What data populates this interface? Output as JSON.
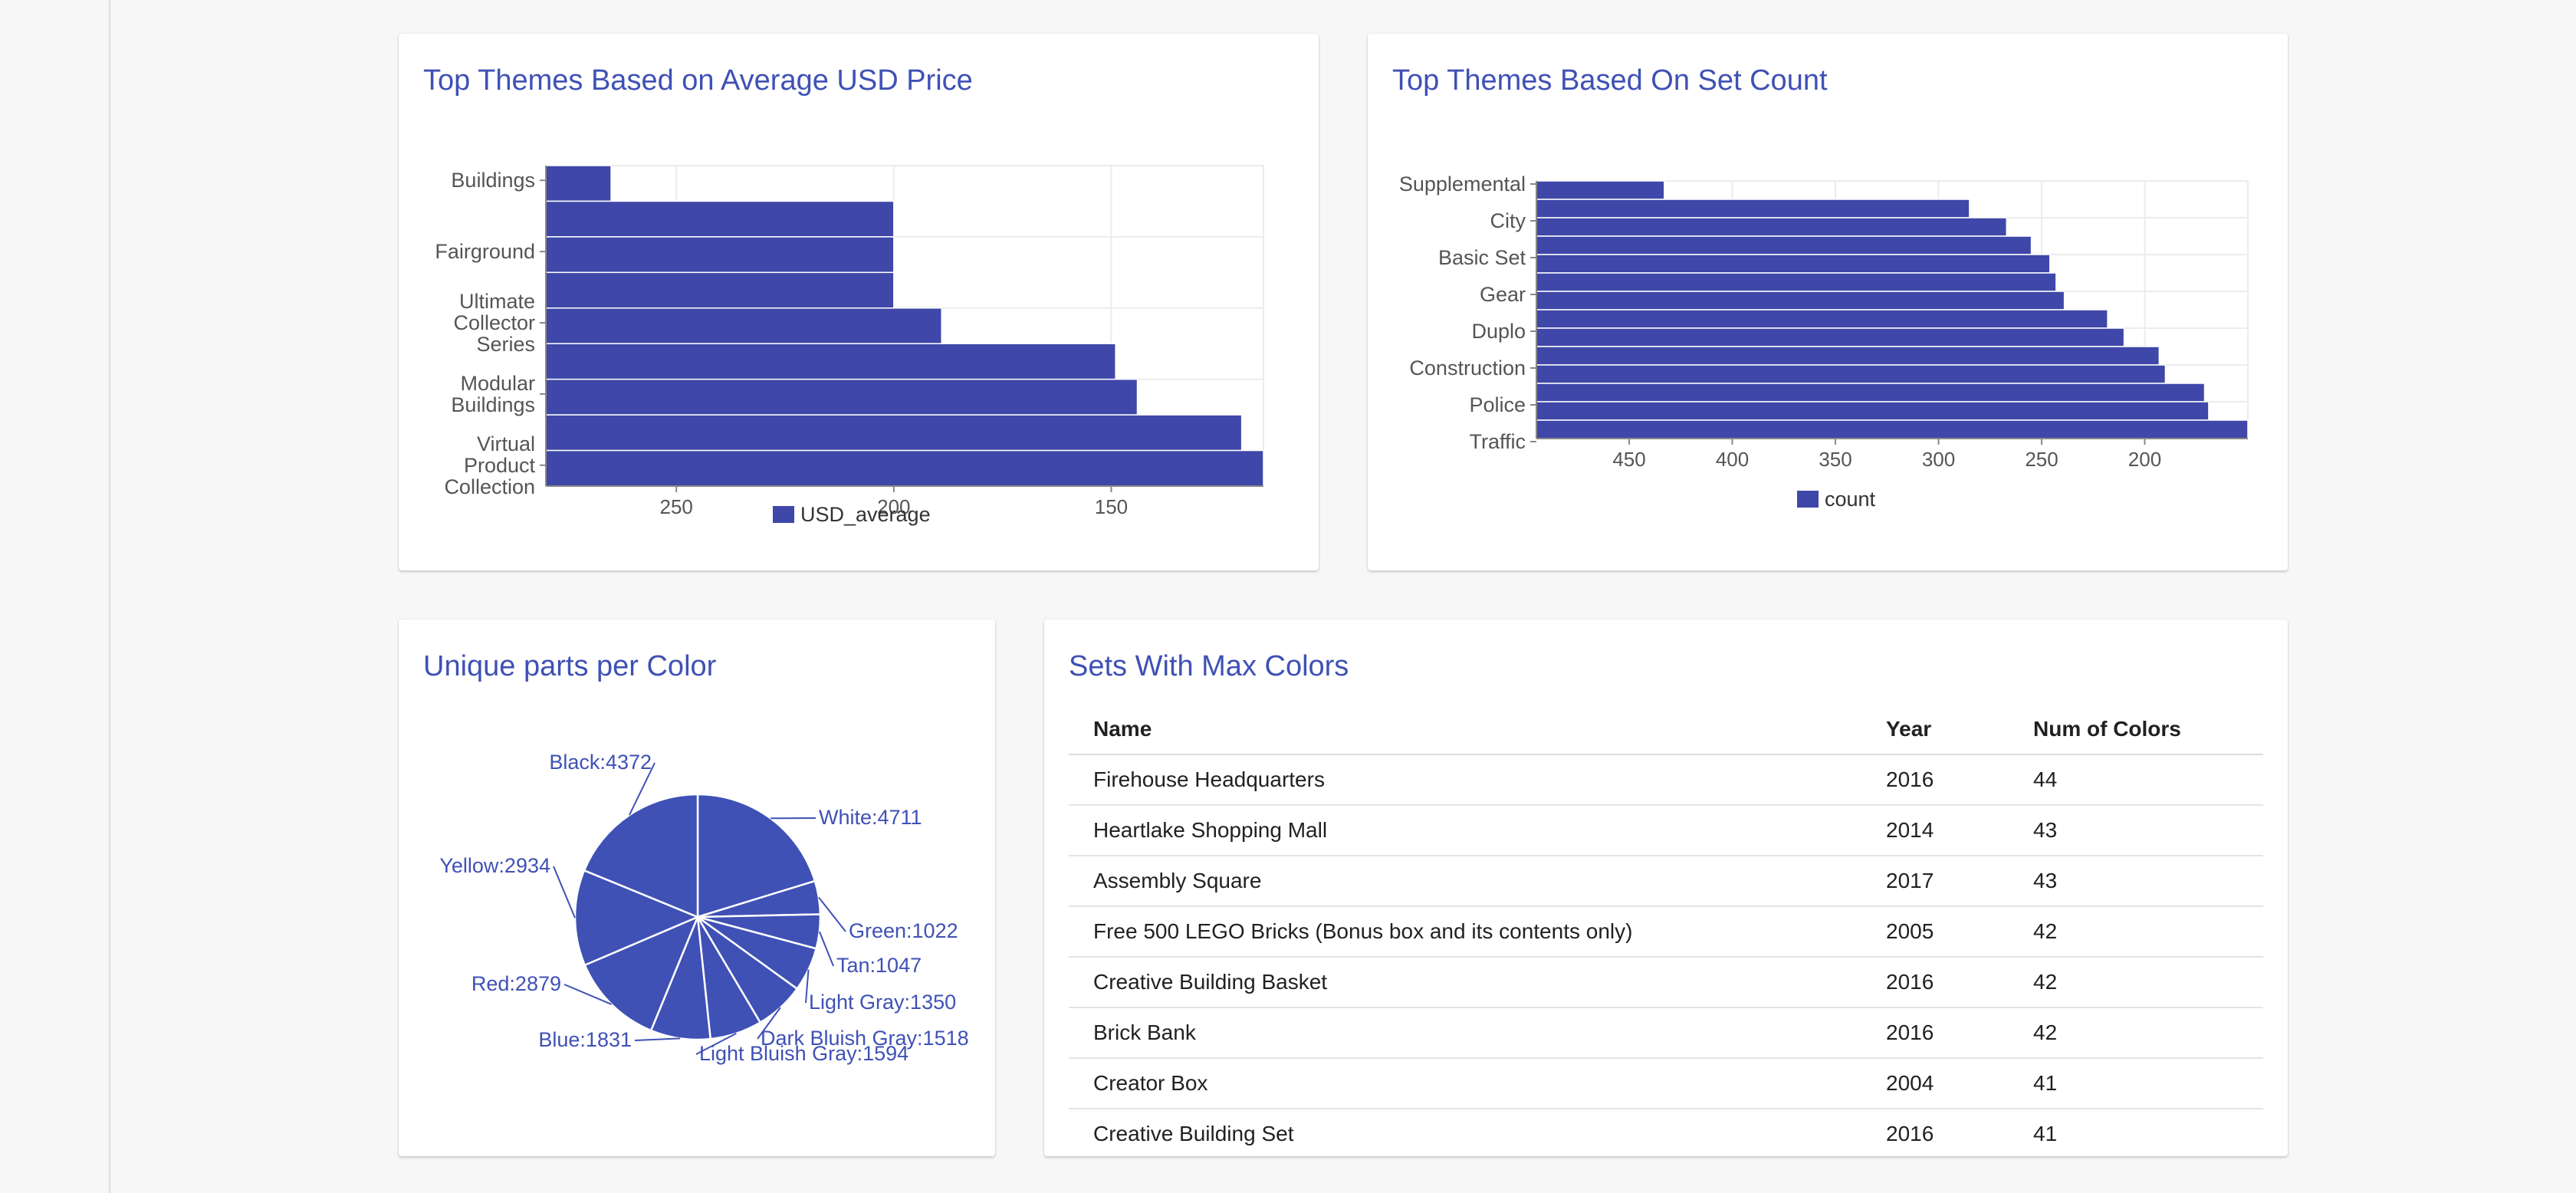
{
  "colors": {
    "accent": "#3f51b5",
    "bar": "#3f47a8",
    "pie": "#3f51b5"
  },
  "avg_price": {
    "title": "Top Themes Based on Average USD Price",
    "chart_data": {
      "type": "bar",
      "orientation": "horizontal",
      "x_reversed": true,
      "xlim": [
        280,
        115
      ],
      "xticks": [
        250,
        200,
        150
      ],
      "ytick_labels": [
        {
          "lines": [
            "Buildings"
          ],
          "index": 0
        },
        {
          "lines": [
            "Fairground"
          ],
          "index": 2
        },
        {
          "lines": [
            "Ultimate",
            "Collector",
            "Series"
          ],
          "index": 4
        },
        {
          "lines": [
            "Modular",
            "Buildings"
          ],
          "index": 6
        },
        {
          "lines": [
            "Virtual",
            "Product",
            "Collection"
          ],
          "index": 8
        }
      ],
      "values": [
        265,
        200,
        200,
        200,
        189,
        149,
        144,
        120,
        115
      ],
      "series": [
        {
          "name": "USD_average"
        }
      ],
      "legend": "bottom",
      "grid": true
    }
  },
  "set_count": {
    "title": "Top Themes Based On Set Count",
    "chart_data": {
      "type": "bar",
      "orientation": "horizontal",
      "x_reversed": true,
      "xlim": [
        495,
        150
      ],
      "xticks": [
        450,
        400,
        350,
        300,
        250,
        200
      ],
      "ytick_labels": [
        {
          "label": "Supplemental",
          "index": 0
        },
        {
          "label": "City",
          "index": 2
        },
        {
          "label": "Basic Set",
          "index": 4
        },
        {
          "label": "Gear",
          "index": 6
        },
        {
          "label": "Duplo",
          "index": 8
        },
        {
          "label": "Construction",
          "index": 10
        },
        {
          "label": "Police",
          "index": 12
        },
        {
          "label": "Traffic",
          "index": 14
        }
      ],
      "values": [
        433,
        285,
        267,
        255,
        246,
        243,
        239,
        218,
        210,
        193,
        190,
        171,
        169,
        150
      ],
      "series": [
        {
          "name": "count"
        }
      ],
      "legend": "bottom",
      "grid": true
    }
  },
  "parts_color": {
    "title": "Unique parts per Color",
    "chart_data": {
      "type": "pie",
      "slices": [
        {
          "name": "White",
          "value": 4711,
          "label": "White:4711"
        },
        {
          "name": "Green",
          "value": 1022,
          "label": "Green:1022"
        },
        {
          "name": "Tan",
          "value": 1047,
          "label": "Tan:1047"
        },
        {
          "name": "Light Gray",
          "value": 1350,
          "label": "Light Gray:1350"
        },
        {
          "name": "Dark Bluish Gray",
          "value": 1518,
          "label": "Dark Bluish Gray:1518"
        },
        {
          "name": "Light Bluish Gray",
          "value": 1594,
          "label": "Light Bluish Gray:1594"
        },
        {
          "name": "Blue",
          "value": 1831,
          "label": "Blue:1831"
        },
        {
          "name": "Red",
          "value": 2879,
          "label": "Red:2879"
        },
        {
          "name": "Yellow",
          "value": 2934,
          "label": "Yellow:2934"
        },
        {
          "name": "Black",
          "value": 4372,
          "label": "Black:4372"
        }
      ]
    }
  },
  "sets_table": {
    "title": "Sets With Max Colors",
    "columns": [
      "Name",
      "Year",
      "Num of Colors"
    ],
    "rows": [
      [
        "Firehouse Headquarters",
        "2016",
        "44"
      ],
      [
        "Heartlake Shopping Mall",
        "2014",
        "43"
      ],
      [
        "Assembly Square",
        "2017",
        "43"
      ],
      [
        "Free 500 LEGO Bricks (Bonus box and its contents only)",
        "2005",
        "42"
      ],
      [
        "Creative Building Basket",
        "2016",
        "42"
      ],
      [
        "Brick Bank",
        "2016",
        "42"
      ],
      [
        "Creator Box",
        "2004",
        "41"
      ],
      [
        "Creative Building Set",
        "2016",
        "41"
      ]
    ]
  }
}
